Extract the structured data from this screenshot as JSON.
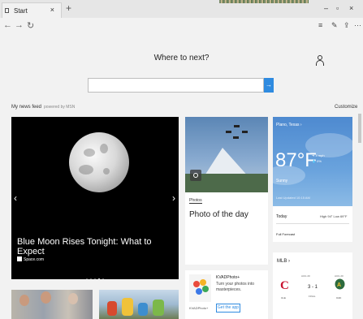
{
  "tab": {
    "title": "Start",
    "close": "×",
    "new_tab": "+"
  },
  "window_controls": {
    "minimize": "–",
    "maximize": "▫",
    "close": "×"
  },
  "nav": {
    "back": "←",
    "forward": "→",
    "refresh": "↻"
  },
  "toolbar": {
    "hub": "≡",
    "note": "✎",
    "share": "⇪",
    "more": "···"
  },
  "search": {
    "heading": "Where to next?",
    "placeholder": "",
    "go": "→"
  },
  "feed": {
    "label": "My news feed",
    "powered": "powered by MSN",
    "customize": "Customize"
  },
  "hero": {
    "title": "Blue Moon Rises Tonight: What to Expect",
    "source": "Space.com",
    "prev": "‹",
    "next": "›",
    "slides": 5,
    "active_slide": 4
  },
  "photo_card": {
    "tag": "Photos",
    "title": "Photo of the day"
  },
  "app_card": {
    "name": "KVADPhoto+",
    "description": "Turn your photos into masterpieces.",
    "subtitle": "KVADPhoto+",
    "button": "Get the app"
  },
  "weather": {
    "location": "Plano, Texas  ›",
    "temperature": "87°F",
    "wind": "➔ 4 mph",
    "precip": "💧 0%",
    "condition": "Sunny",
    "updated": "Last Updated 10:15 AM",
    "today_label": "Today",
    "hilo": "High 94°  Low 69°F",
    "forecast": "Full Forecast"
  },
  "mlb": {
    "title": "MLB  ›",
    "date_left": "AUG 20",
    "date_right": "AUG 20",
    "score": "3 - 1",
    "status": "FINAL",
    "team_left": "CLE",
    "team_right": "OAK",
    "colors": {
      "cle": "#c8102e",
      "oak": "#2d6b3e"
    }
  },
  "colors": {
    "accent": "#2f8be0",
    "weather_bg": "#5a95d6",
    "hero_bg": "#000000"
  }
}
